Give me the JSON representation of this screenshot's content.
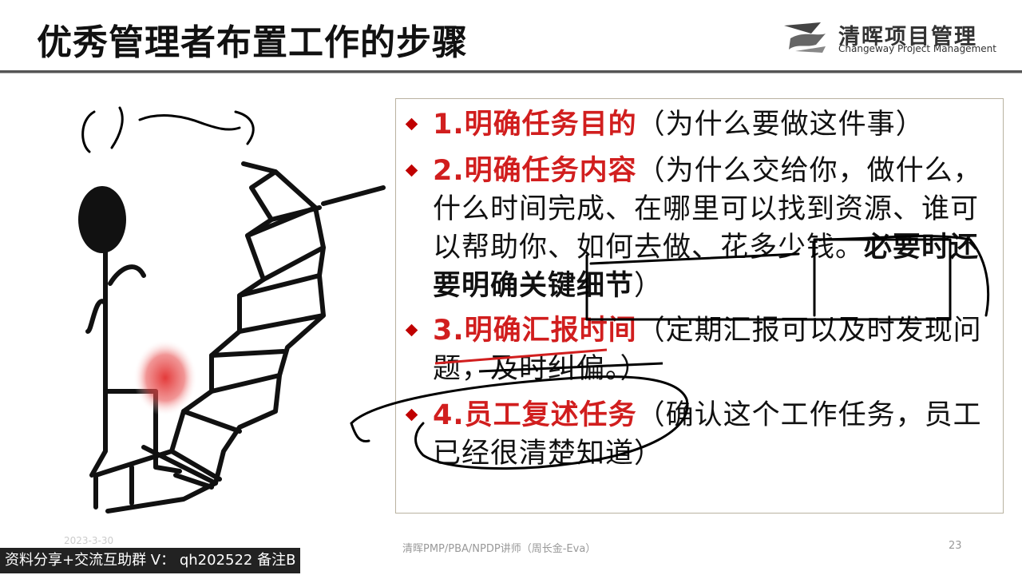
{
  "slide": {
    "title": "优秀管理者布置工作的步骤",
    "logo": {
      "name_cn": "清晖项目管理",
      "name_en": "Changeway Project Management"
    },
    "steps": [
      {
        "heading": "1.明确任务目的",
        "text": "（为什么要做这件事）"
      },
      {
        "heading": "2.明确任务内容",
        "text": "（为什么交给你，做什么，什么时间完成、在哪里可以找到资源、谁可以帮助你、如何去做、花多少钱。",
        "emphasis": "必要时还要明确关键细节",
        "close": "）"
      },
      {
        "heading": "3.明确汇报时间",
        "text": "（定期汇报可以及时发现问题，及时纠偏。）"
      },
      {
        "heading": "4.员工复述任务",
        "text": "（确认这个工作任务，员工已经很清楚知道）"
      }
    ],
    "footer": "清晖PMP/PBA/NPDP讲师（周长金-Eva）",
    "date_faint": "2023-3-30",
    "page_number": "23"
  },
  "overlay_banner": "资料分享+交流互助群 V： qh202522 备注B",
  "colors": {
    "accent_red": "#d11e1e",
    "bullet": "#c00000",
    "box_border": "#b9b2a0"
  },
  "icons": [
    "diamond-bullet-icon",
    "changeway-logo-icon"
  ]
}
